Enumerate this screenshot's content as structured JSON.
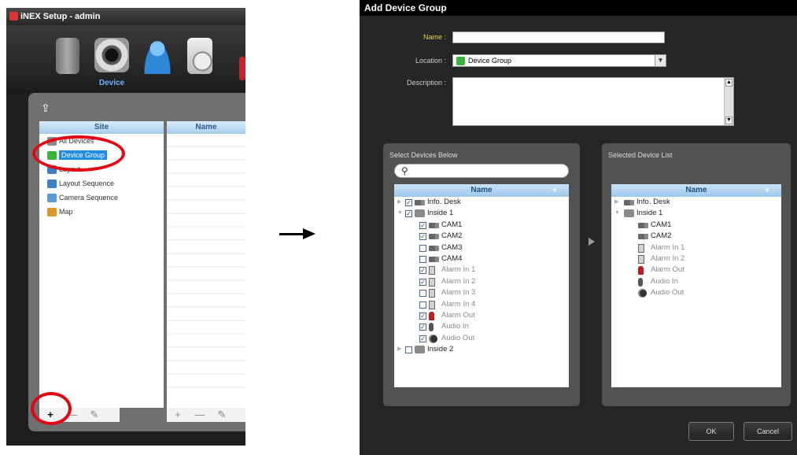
{
  "left_window": {
    "title": "iNEX Setup - admin",
    "toolbar": {
      "items": [
        {
          "icon": "server-icon",
          "label": ""
        },
        {
          "icon": "camera-icon",
          "label": "Device"
        },
        {
          "icon": "user-icon",
          "label": ""
        },
        {
          "icon": "log-document-icon",
          "label": ""
        }
      ]
    },
    "site_header": "Site",
    "name_header": "Name",
    "site_items": [
      {
        "label": "All Devices",
        "icon": "all-devices-icon"
      },
      {
        "label": "Device Group",
        "icon": "device-group-icon",
        "selected": true
      },
      {
        "label": "Layout",
        "icon": "layout-icon"
      },
      {
        "label": "Layout Sequence",
        "icon": "layout-sequence-icon"
      },
      {
        "label": "Camera Sequence",
        "icon": "camera-sequence-icon"
      },
      {
        "label": "Map",
        "icon": "map-icon"
      }
    ],
    "site_bottom": {
      "add": "+",
      "remove": "—",
      "edit": "✎"
    },
    "name_bottom": {
      "add": "+",
      "remove": "—",
      "edit": "✎"
    }
  },
  "dialog": {
    "title": "Add Device Group",
    "name_label": "Name :",
    "name_value": "",
    "location_label": "Location :",
    "location_value": "Device Group",
    "description_label": "Description :",
    "select_panel_title": "Select Devices Below",
    "selected_panel_title": "Selected Device List",
    "tree_header": "Name",
    "left_tree": [
      {
        "label": "Info. Desk",
        "level": 0,
        "expander": "▶",
        "checked": true,
        "icon": "camera-icon",
        "dim": false
      },
      {
        "label": "Inside 1",
        "level": 0,
        "expander": "▼",
        "checked": true,
        "icon": "group-icon",
        "dim": false
      },
      {
        "label": "CAM1",
        "level": 1,
        "checked": true,
        "icon": "camera-icon",
        "dim": false
      },
      {
        "label": "CAM2",
        "level": 1,
        "checked": true,
        "icon": "camera-icon",
        "dim": false
      },
      {
        "label": "CAM3",
        "level": 1,
        "checked": false,
        "icon": "camera-icon",
        "dim": false
      },
      {
        "label": "CAM4",
        "level": 1,
        "checked": false,
        "icon": "camera-icon",
        "dim": false
      },
      {
        "label": "Alarm In 1",
        "level": 1,
        "checked": true,
        "icon": "alarm-in-icon",
        "dim": true
      },
      {
        "label": "Alarm In 2",
        "level": 1,
        "checked": true,
        "icon": "alarm-in-icon",
        "dim": true
      },
      {
        "label": "Alarm In 3",
        "level": 1,
        "checked": false,
        "icon": "alarm-in-icon",
        "dim": true
      },
      {
        "label": "Alarm In 4",
        "level": 1,
        "checked": false,
        "icon": "alarm-in-icon",
        "dim": true
      },
      {
        "label": "Alarm Out",
        "level": 1,
        "checked": true,
        "icon": "alarm-out-icon",
        "dim": true
      },
      {
        "label": "Audio In",
        "level": 1,
        "checked": true,
        "icon": "audio-in-icon",
        "dim": true
      },
      {
        "label": "Audio Out",
        "level": 1,
        "checked": true,
        "icon": "audio-out-icon",
        "dim": true
      },
      {
        "label": "Inside 2",
        "level": 0,
        "expander": "▶",
        "checked": false,
        "icon": "group-icon",
        "dim": false
      }
    ],
    "right_tree": [
      {
        "label": "Info. Desk",
        "level": 0,
        "expander": "▶",
        "icon": "camera-icon",
        "dim": false
      },
      {
        "label": "Inside 1",
        "level": 0,
        "expander": "▼",
        "icon": "group-icon",
        "dim": false
      },
      {
        "label": "CAM1",
        "level": 1,
        "icon": "camera-icon",
        "dim": false
      },
      {
        "label": "CAM2",
        "level": 1,
        "icon": "camera-icon",
        "dim": false
      },
      {
        "label": "Alarm In 1",
        "level": 1,
        "icon": "alarm-in-icon",
        "dim": true
      },
      {
        "label": "Alarm In 2",
        "level": 1,
        "icon": "alarm-in-icon",
        "dim": true
      },
      {
        "label": "Alarm Out",
        "level": 1,
        "icon": "alarm-out-icon",
        "dim": true
      },
      {
        "label": "Audio In",
        "level": 1,
        "icon": "audio-in-icon",
        "dim": true
      },
      {
        "label": "Audio Out",
        "level": 1,
        "icon": "audio-out-icon",
        "dim": true
      }
    ],
    "ok_label": "OK",
    "cancel_label": "Cancel"
  },
  "colors": {
    "selection": "#1f8de6",
    "annotation_circle": "#e30613",
    "name_label": "#e6d34a"
  }
}
